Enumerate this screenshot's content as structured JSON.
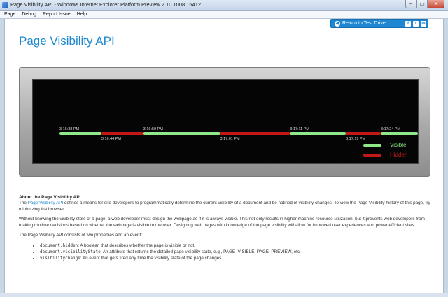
{
  "window": {
    "title": "Page Visibility API - Windows Internet Explorer Platform Preview 2.10.1008.16412",
    "minimize_glyph": "–",
    "maximize_glyph": "▭",
    "close_glyph": "✕"
  },
  "menu": [
    "Page",
    "Debug",
    "Report Issue",
    "Help"
  ],
  "header": {
    "return_label": "Return to Test Drive",
    "social": [
      {
        "icon": "facebook-icon",
        "glyph": "f"
      },
      {
        "icon": "twitter-icon",
        "glyph": "t"
      },
      {
        "icon": "email-icon",
        "glyph": "✉"
      }
    ]
  },
  "page_title": "Page Visibility API",
  "timeline": {
    "colors": {
      "visible": "#8fe88a",
      "hidden": "#c41818"
    },
    "upper_times": [
      "3:16:38 PM",
      "3:16:50 PM",
      "3:17:11 PM",
      "3:17:24 PM"
    ],
    "lower_times": [
      "3:16:44 PM",
      "3:17:01 PM",
      "3:17:19 PM"
    ],
    "segments": [
      {
        "state": "visible",
        "from": "3:16:38 PM",
        "to": "3:16:44 PM"
      },
      {
        "state": "hidden",
        "from": "3:16:44 PM",
        "to": "3:16:50 PM"
      },
      {
        "state": "visible",
        "from": "3:16:50 PM",
        "to": "3:17:01 PM"
      },
      {
        "state": "hidden",
        "from": "3:17:01 PM",
        "to": "3:17:11 PM"
      },
      {
        "state": "visible",
        "from": "3:17:11 PM",
        "to": "3:17:19 PM"
      },
      {
        "state": "hidden",
        "from": "3:17:19 PM",
        "to": "3:17:24 PM"
      },
      {
        "state": "visible",
        "from": "3:17:24 PM",
        "to": ""
      }
    ],
    "legend": {
      "visible": "Visible",
      "hidden": "Hidden"
    }
  },
  "about": {
    "heading": "About the Page Visibility API",
    "p1_prefix": "The ",
    "p1_link": "Page Visibility API",
    "p1_rest": " defines a means for site developers to programmatically determine the current visibility of a document and be notified of visibility changes. To view the Page Visibility history of this page, try minimizing the browser.",
    "p2": "Without knowing the visibility state of a page, a web developer must design the webpage as if it is always visible. This not only results in higher machine resource utilization, but it prevents web developers from making runtime decisions based on whether the webpage is visible to the user. Designing web pages with knowledge of the page visibility will allow for improved user experiences and power efficient sites.",
    "p3": "The Page Visibility API consists of two properties and an event:",
    "bullets": [
      {
        "code": "document.hidden",
        "text": ": A boolean that describes whether the page is visible or not."
      },
      {
        "code": "document.visibilityState",
        "text": ": An attribute that returns the detailed page visibility state, e.g., PAGE_VISIBLE, PAGE_PREVIEW, etc."
      },
      {
        "code": "visibilitychange",
        "text": ": An event that gets fired any time the visibility state of the page changes."
      }
    ]
  }
}
